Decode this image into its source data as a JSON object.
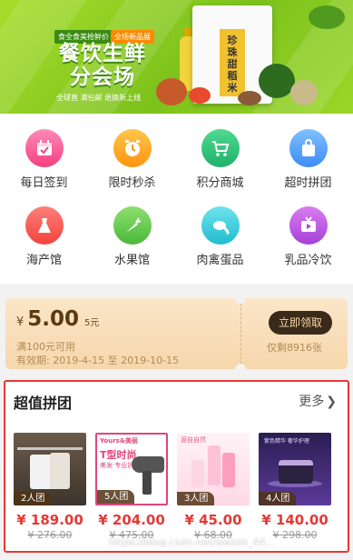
{
  "banner": {
    "tag1": "食全食美抢鲜价",
    "tag2": "全场新品展",
    "title_line1": "餐饮生鲜",
    "title_line2": "分会场",
    "subtitle": "全球直 满包邮 退换新上线",
    "product_name": "珍珠甜稻米"
  },
  "categories": [
    {
      "label": "每日签到",
      "icon": "calendar-icon"
    },
    {
      "label": "限时秒杀",
      "icon": "alarm-clock-icon"
    },
    {
      "label": "积分商城",
      "icon": "cart-icon"
    },
    {
      "label": "超时拼团",
      "icon": "bag-icon"
    },
    {
      "label": "海产馆",
      "icon": "dress-icon"
    },
    {
      "label": "水果馆",
      "icon": "carrot-icon"
    },
    {
      "label": "肉禽蛋品",
      "icon": "chicken-icon"
    },
    {
      "label": "乳品冷饮",
      "icon": "tv-icon"
    }
  ],
  "coupon": {
    "currency": "¥",
    "amount": "5.00",
    "unit": "5元",
    "condition": "满100元可用",
    "validity": "有效期: 2019-4-15 至 2019-10-15",
    "button": "立即领取",
    "remaining": "仅剩8916张"
  },
  "group": {
    "title": "超值拼团",
    "more": "更多",
    "products": [
      {
        "badge": "2人团",
        "price": "¥ 189.00",
        "original": "¥ 276.00"
      },
      {
        "badge": "5人团",
        "price": "¥ 204.00",
        "original": "¥ 475.00",
        "img_text1": "Yours&美丽",
        "img_text2": "T型时尚",
        "img_text3": "美发·专业护发"
      },
      {
        "badge": "3人团",
        "price": "¥ 45.00",
        "original": "¥ 68.00",
        "img_text1": "源自自然"
      },
      {
        "badge": "4人团",
        "price": "¥ 140.00",
        "original": "¥ 298.00",
        "img_text1": "紫色精华 奢华护理"
      }
    ]
  },
  "watermark": "https://blog.csdn.net/weixin_44..."
}
